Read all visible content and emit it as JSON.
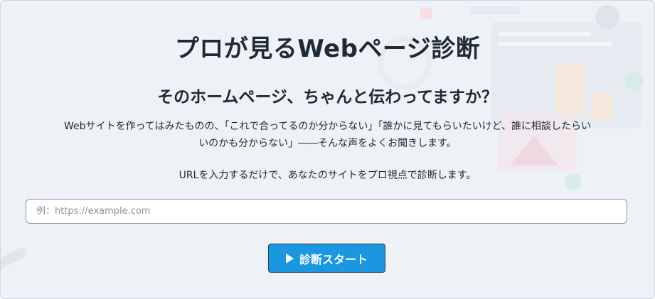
{
  "page": {
    "title": "プロが見るWebページ診断",
    "subtitle": "そのホームページ、ちゃんと伝わってますか？",
    "description_line1": "Webサイトを作ってはみたものの、「これで合ってるのか分からない」「誰かに見てもらいたいけど、誰に相談したらい",
    "description_line2": "いのかも分からない」――そんな声をよくお聞きします。",
    "note": "URLを入力するだけで、あなたのサイトをプロ視点で診断します。"
  },
  "form": {
    "url_placeholder": "例：https://example.com",
    "url_value": "",
    "start_label": "診断スタート",
    "start_icon": "play-icon"
  },
  "colors": {
    "background": "#eef1f5",
    "accent": "#1a97e0",
    "text": "#1f2a37"
  }
}
